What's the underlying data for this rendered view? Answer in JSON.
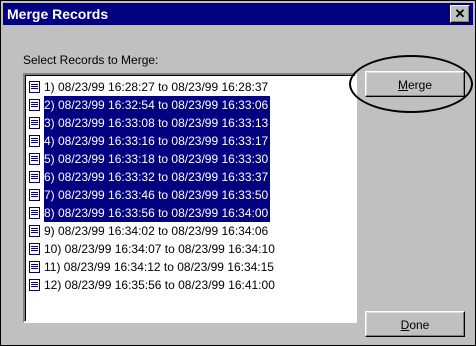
{
  "window": {
    "title": "Merge Records",
    "close_glyph": "✕"
  },
  "prompt": "Select Records to Merge:",
  "records": [
    {
      "label": "1) 08/23/99 16:28:27 to 08/23/99 16:28:37",
      "selected": false
    },
    {
      "label": "2) 08/23/99 16:32:54 to 08/23/99 16:33:06",
      "selected": true
    },
    {
      "label": "3) 08/23/99 16:33:08 to 08/23/99 16:33:13",
      "selected": true
    },
    {
      "label": "4) 08/23/99 16:33:16 to 08/23/99 16:33:17",
      "selected": true
    },
    {
      "label": "5) 08/23/99 16:33:18 to 08/23/99 16:33:30",
      "selected": true
    },
    {
      "label": "6) 08/23/99 16:33:32 to 08/23/99 16:33:37",
      "selected": true
    },
    {
      "label": "7) 08/23/99 16:33:46 to 08/23/99 16:33:50",
      "selected": true
    },
    {
      "label": "8) 08/23/99 16:33:56 to 08/23/99 16:34:00",
      "selected": true
    },
    {
      "label": "9) 08/23/99 16:34:02 to 08/23/99 16:34:06",
      "selected": false
    },
    {
      "label": "10) 08/23/99 16:34:07 to 08/23/99 16:34:10",
      "selected": false
    },
    {
      "label": "11) 08/23/99 16:34:12 to 08/23/99 16:34:15",
      "selected": false
    },
    {
      "label": "12) 08/23/99 16:35:56 to 08/23/99 16:41:00",
      "selected": false
    }
  ],
  "buttons": {
    "merge_first": "M",
    "merge_rest": "erge",
    "done_first": "D",
    "done_rest": "one"
  },
  "icons": {
    "record": "record-icon",
    "close": "close-icon"
  },
  "colors": {
    "selection": "#000080",
    "dialog_face": "#c0c0c0"
  }
}
